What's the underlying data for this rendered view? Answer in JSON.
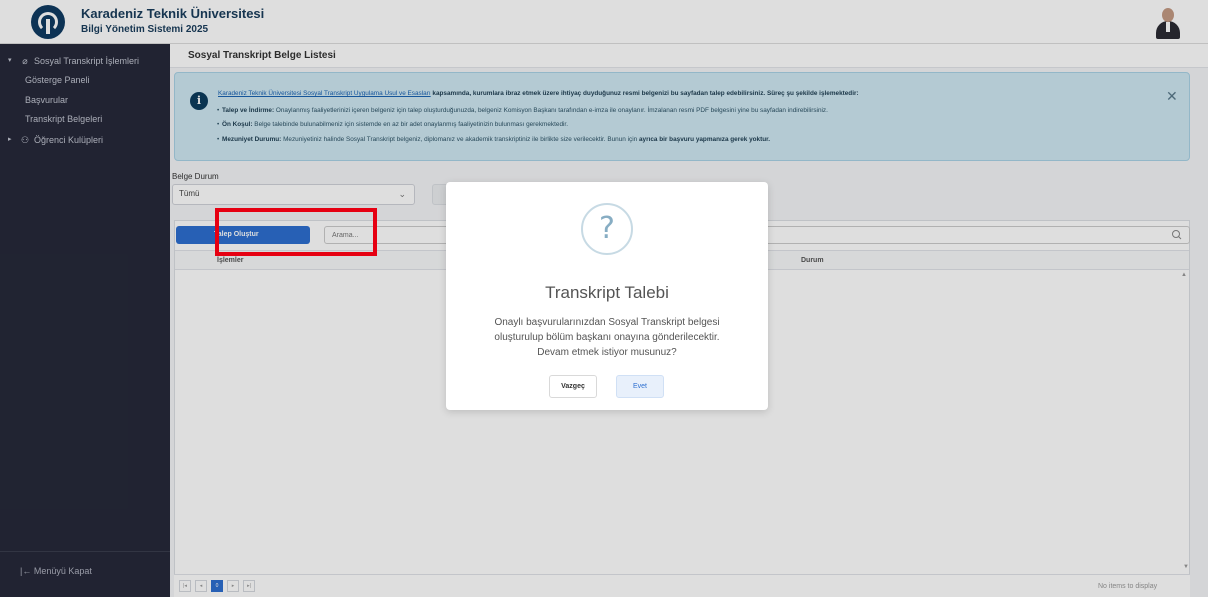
{
  "header": {
    "university": "Karadeniz Teknik Üniversitesi",
    "system": "Bilgi Yönetim Sistemi 2025"
  },
  "sidebar": {
    "section": "Sosyal Transkript İşlemleri",
    "items": [
      {
        "label": "Gösterge Paneli"
      },
      {
        "label": "Başvurular"
      },
      {
        "label": "Transkript Belgeleri"
      }
    ],
    "clubs": "Öğrenci Kulüpleri",
    "close_menu": "Menüyü Kapat"
  },
  "page": {
    "title": "Sosyal Transkript Belge Listesi"
  },
  "alert": {
    "link": "Karadeniz Teknik Üniversitesi Sosyal Transkript Uygulama Usul ve Esasları",
    "intro": " kapsamında, kurumlara ibraz etmek üzere ihtiyaç duyduğunuz resmi belgenizi bu sayfadan talep edebilirsiniz. Süreç şu şekilde işlemektedir:",
    "b1_title": "Talep ve İndirme:",
    "b1_text": " Onaylanmış faaliyetlerinizi içeren belgeniz için talep oluşturduğunuzda, belgeniz Komisyon Başkanı tarafından e-imza ile onaylanır. İmzalanan resmi PDF belgesini yine bu sayfadan indirebilirsiniz.",
    "b2_title": "Ön Koşul:",
    "b2_text": " Belge talebinde bulunabilmeniz için sistemde en az bir adet onaylanmış faaliyetinizin bulunması gerekmektedir.",
    "b3_title": "Mezuniyet Durumu:",
    "b3_text": " Mezuniyetiniz halinde Sosyal Transkript belgeniz, diplomanız ve akademik transkriptiniz ile birlikte size verilecektir. Bunun için ",
    "b3_bold": "ayrıca bir başvuru yapmanıza gerek yoktur."
  },
  "filter": {
    "label": "Belge Durum",
    "selected": "Tümü"
  },
  "grid": {
    "create_button": "Talep Oluştur",
    "search_placeholder": "Arama...",
    "columns": [
      "İşlemler",
      "Durum"
    ],
    "page": "0",
    "empty_text": "No items to display"
  },
  "modal": {
    "icon": "?",
    "title": "Transkript Talebi",
    "line1": "Onaylı başvurularınızdan Sosyal Transkript belgesi",
    "line2": "oluşturulup bölüm başkanı onayına gönderilecektir.",
    "line3": "Devam etmek istiyor musunuz?",
    "cancel": "Vazgeç",
    "confirm": "Evet"
  },
  "colors": {
    "primary": "#2d6fd0",
    "sidebar_bg": "#26293a",
    "alert_bg": "#cfe8f3",
    "highlight": "#e60012"
  }
}
